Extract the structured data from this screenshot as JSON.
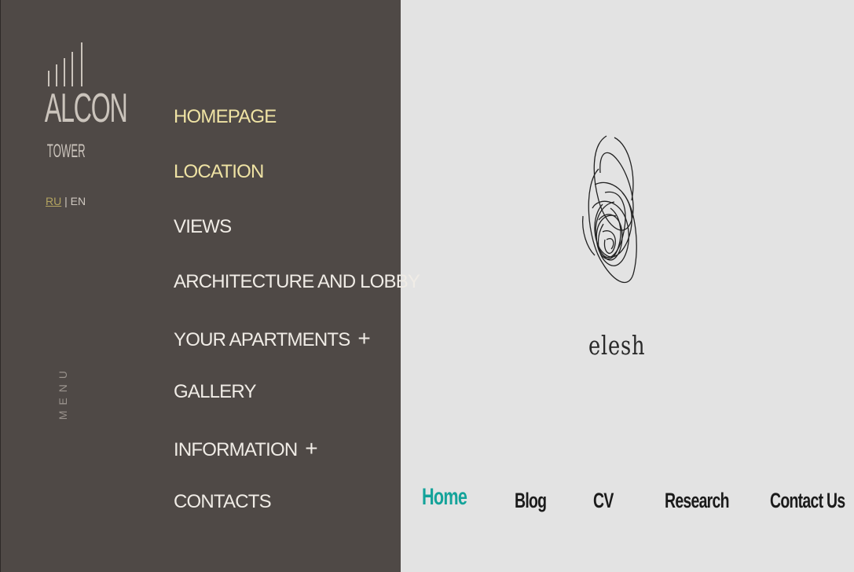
{
  "left": {
    "logo": {
      "word": "ALCON",
      "sub": "TOWER"
    },
    "lang": {
      "ru": "RU",
      "sep": "|",
      "en": "EN"
    },
    "menu_label": "MENU",
    "nav": [
      {
        "label": "HOMEPAGE",
        "active": true,
        "plus": ""
      },
      {
        "label": "LOCATION",
        "active": true,
        "plus": ""
      },
      {
        "label": "VIEWS",
        "active": false,
        "plus": ""
      },
      {
        "label": "ARCHITECTURE AND LOBBY",
        "active": false,
        "plus": ""
      },
      {
        "label": "YOUR APARTMENTS",
        "active": false,
        "plus": "+"
      },
      {
        "label": "GALLERY",
        "active": false,
        "plus": ""
      },
      {
        "label": "INFORMATION",
        "active": false,
        "plus": "+"
      },
      {
        "label": "CONTACTS",
        "active": false,
        "plus": ""
      }
    ]
  },
  "right": {
    "brand": "elesh",
    "nav": [
      {
        "label": "Home",
        "current": true
      },
      {
        "label": "Blog",
        "current": false
      },
      {
        "label": "CV",
        "current": false
      },
      {
        "label": "Research",
        "current": false
      },
      {
        "label": "Contact Us",
        "current": false
      }
    ]
  },
  "colors": {
    "panel": "#4f4946",
    "active_nav": "#efe3a4",
    "accent_teal": "#14a39a",
    "right_bg": "#e3e3e3"
  }
}
